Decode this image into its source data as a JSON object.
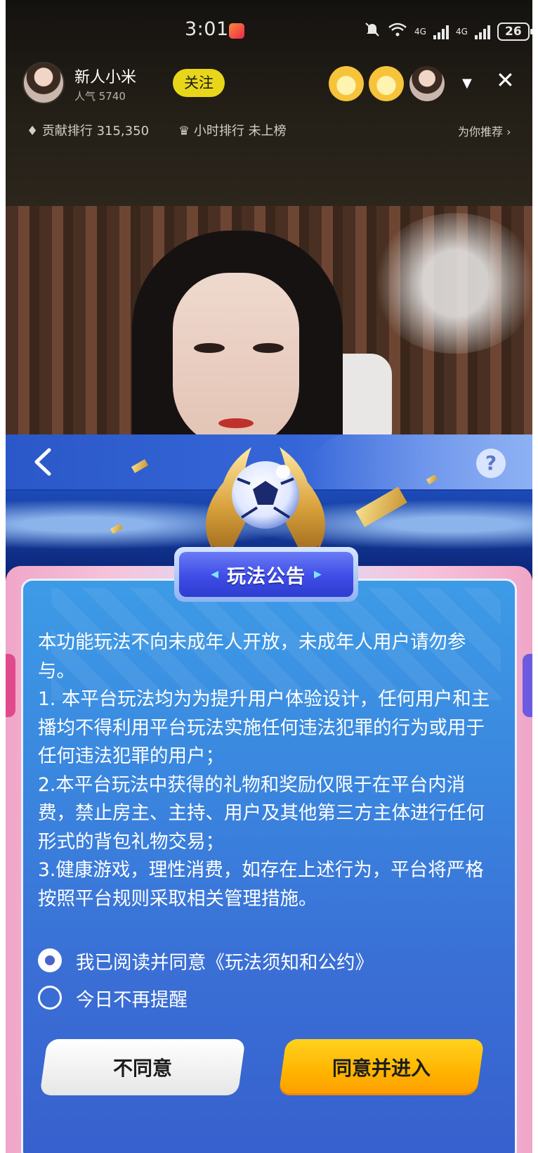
{
  "status_bar": {
    "time": "3:01",
    "network_1": "4G",
    "network_2": "4G",
    "battery": "26"
  },
  "streamer": {
    "name": "新人小米",
    "popularity": "人气 5740",
    "follow_label": "关注"
  },
  "ranks": {
    "contribution": "贡献排行 315,350",
    "hourly": "小时排行 未上榜",
    "recommend": "为你推荐 ›"
  },
  "game": {
    "help_label": "?"
  },
  "notice": {
    "title": "玩法公告",
    "paragraphs": [
      "本功能玩法不向未成年人开放，未成年人用户请勿参与。",
      "1. 本平台玩法均为为提升用户体验设计，任何用户和主播均不得利用平台玩法实施任何违法犯罪的行为或用于任何违法犯罪的用户；",
      "2.本平台玩法中获得的礼物和奖励仅限于在平台内消费，禁止房主、主持、用户及其他第三方主体进行任何形式的背包礼物交易；",
      "3.健康游戏，理性消费，如存在上述行为，平台将严格按照平台规则采取相关管理措施。"
    ],
    "agree_option": "我已阅读并同意《玩法须知和公约》",
    "no_remind_option": "今日不再提醒",
    "agree_checked": true,
    "no_remind_checked": false,
    "disagree_button": "不同意",
    "agree_button": "同意并进入"
  },
  "colors": {
    "follow": "#e8d61b",
    "card_blue": "#3a86df",
    "agree_button": "#ffb300",
    "title_blue": "#3f4ce6"
  },
  "icons": {
    "back": "chevron-left-icon",
    "help": "question-icon",
    "close": "close-icon",
    "more": "caret-down-icon",
    "diamond": "diamond-icon",
    "crown": "crown-icon"
  }
}
